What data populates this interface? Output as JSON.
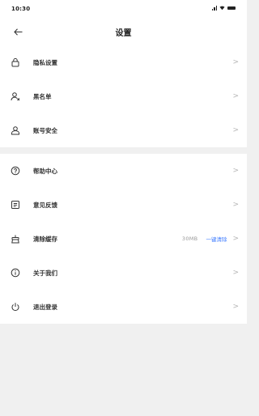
{
  "status": {
    "time": "10:30"
  },
  "nav": {
    "title": "设置"
  },
  "groups": [
    [
      {
        "icon": "lock-icon",
        "label": "隐私设置"
      },
      {
        "icon": "block-user-icon",
        "label": "黑名单"
      },
      {
        "icon": "user-shield-icon",
        "label": "账号安全"
      }
    ],
    [
      {
        "icon": "help-icon",
        "label": "帮助中心"
      },
      {
        "icon": "feedback-icon",
        "label": "意见反馈"
      },
      {
        "icon": "broom-icon",
        "label": "清除缓存",
        "value": "30MB",
        "action": "一键清除"
      },
      {
        "icon": "info-icon",
        "label": "关于我们"
      },
      {
        "icon": "power-icon",
        "label": "退出登录"
      }
    ]
  ],
  "colors": {
    "accent": "#3d7bff",
    "background": "#f0f0f0"
  }
}
